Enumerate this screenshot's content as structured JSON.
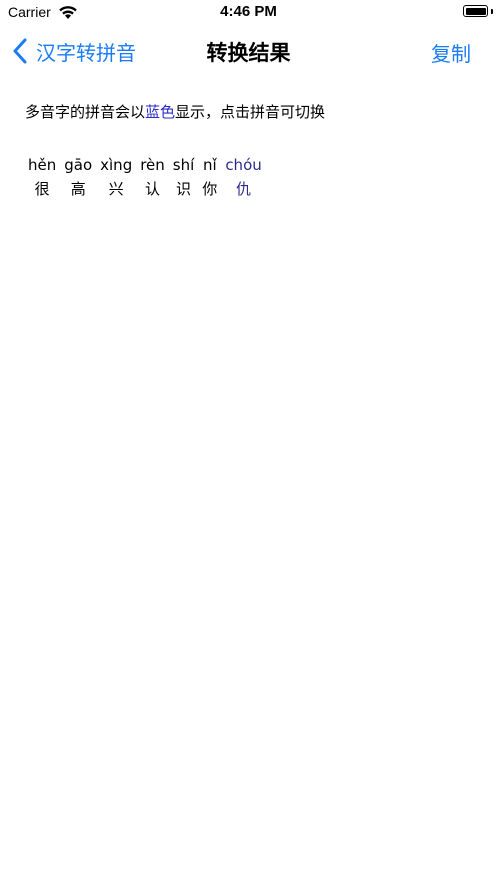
{
  "status_bar": {
    "carrier": "Carrier",
    "time": "4:46 PM"
  },
  "nav": {
    "back_label": "汉字转拼音",
    "title": "转换结果",
    "copy_label": "复制"
  },
  "hint": {
    "before": "多音字的拼音会以",
    "highlight": "蓝色",
    "after": "显示，点击拼音可切换"
  },
  "characters": [
    {
      "pinyin": "hěn",
      "hanzi": "很"
    },
    {
      "pinyin": "gāo",
      "hanzi": "高"
    },
    {
      "pinyin": "xìng",
      "hanzi": "兴"
    },
    {
      "pinyin": "rèn",
      "hanzi": "认"
    },
    {
      "pinyin": "shí",
      "hanzi": "识"
    },
    {
      "pinyin": "nǐ",
      "hanzi": "你"
    },
    {
      "pinyin": "chóu",
      "hanzi": "仇"
    }
  ],
  "colors": {
    "accent": "#1a7cf5",
    "polyphone": "#2b2b8c"
  }
}
